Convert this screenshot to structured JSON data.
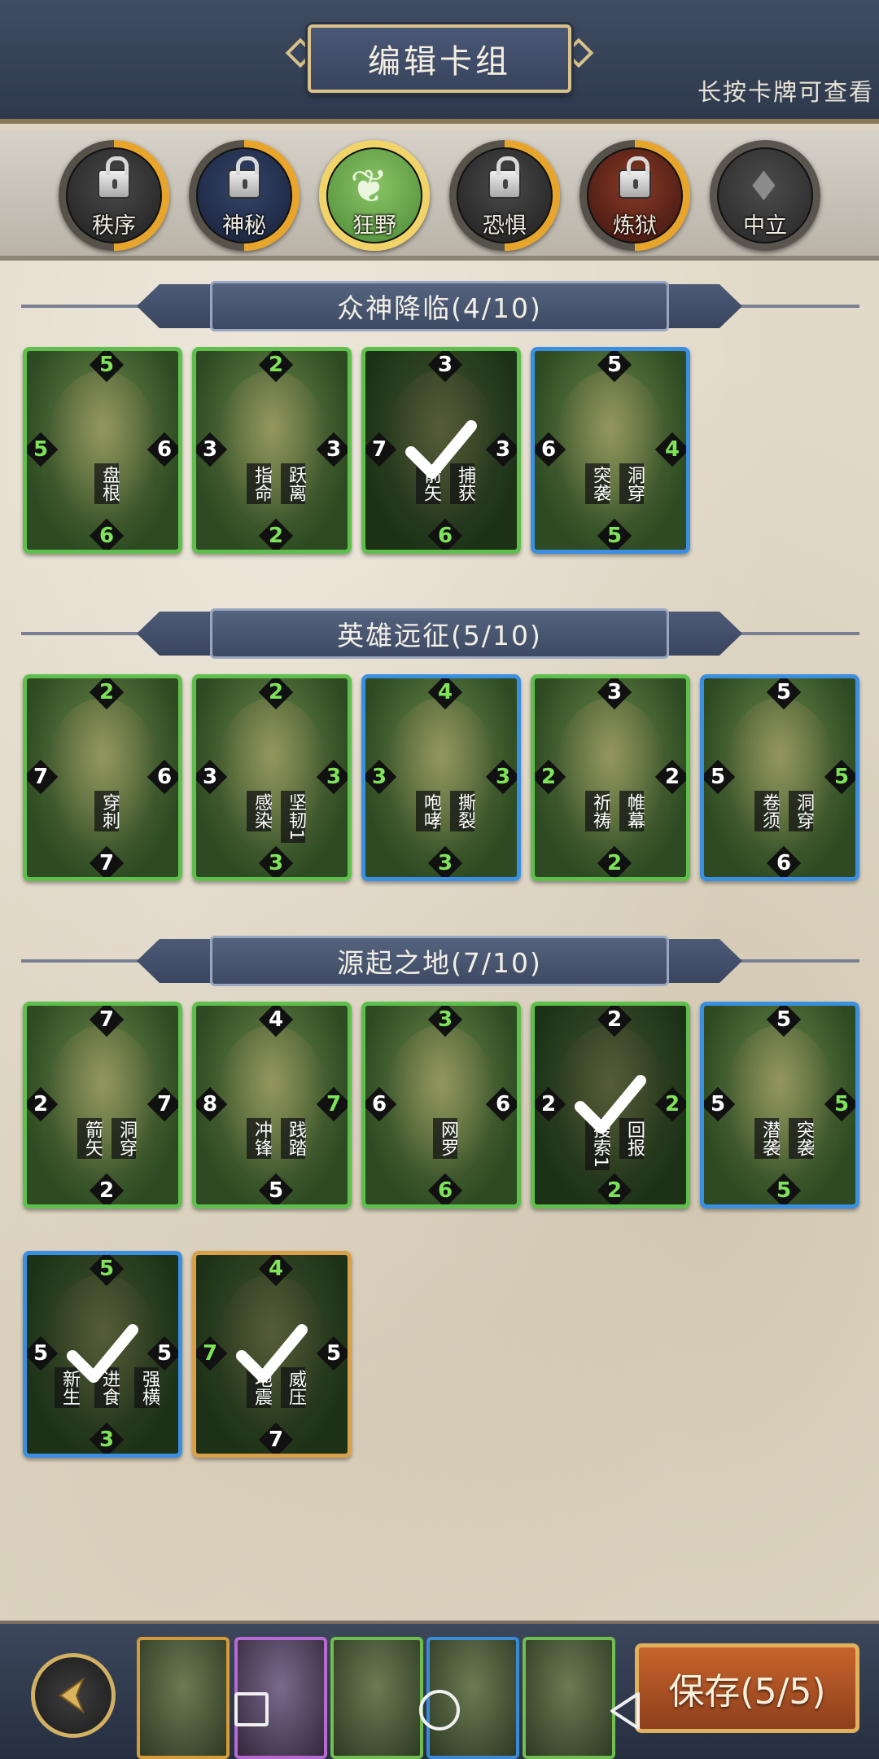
{
  "header": {
    "title": "编辑卡组",
    "hint": "长按卡牌可查看"
  },
  "factions": [
    {
      "name": "秩序",
      "locked": true
    },
    {
      "name": "神秘",
      "locked": true
    },
    {
      "name": "狂野",
      "locked": false,
      "active": true
    },
    {
      "name": "恐惧",
      "locked": true
    },
    {
      "name": "炼狱",
      "locked": true
    },
    {
      "name": "中立",
      "locked": false
    }
  ],
  "sections": [
    {
      "title": "众神降临(4/10)",
      "cards": [
        {
          "frame": "green",
          "top": "5",
          "bottom": "6",
          "left": "5",
          "right": "6",
          "top_green": true,
          "bottom_green": true,
          "left_green": true,
          "right_green": false,
          "skills": [
            "盘根"
          ],
          "selected": false
        },
        {
          "frame": "green",
          "top": "2",
          "bottom": "2",
          "left": "3",
          "right": "3",
          "top_green": true,
          "bottom_green": true,
          "left_green": false,
          "right_green": false,
          "skills": [
            "指命",
            "跃离"
          ],
          "selected": false
        },
        {
          "frame": "green",
          "top": "3",
          "bottom": "6",
          "left": "7",
          "right": "3",
          "top_green": false,
          "bottom_green": true,
          "left_green": false,
          "right_green": false,
          "skills": [
            "箭矢",
            "捕获"
          ],
          "selected": true
        },
        {
          "frame": "blue",
          "top": "5",
          "bottom": "5",
          "left": "6",
          "right": "4",
          "top_green": false,
          "bottom_green": true,
          "left_green": false,
          "right_green": true,
          "skills": [
            "突袭",
            "洞穿"
          ],
          "selected": false
        }
      ]
    },
    {
      "title": "英雄远征(5/10)",
      "cards": [
        {
          "frame": "green",
          "top": "2",
          "bottom": "7",
          "left": "7",
          "right": "6",
          "top_green": true,
          "bottom_green": false,
          "left_green": false,
          "right_green": false,
          "skills": [
            "穿刺"
          ],
          "selected": false
        },
        {
          "frame": "green",
          "top": "2",
          "bottom": "3",
          "left": "3",
          "right": "3",
          "top_green": true,
          "bottom_green": true,
          "left_green": false,
          "right_green": true,
          "skills": [
            "感染",
            "坚韧1"
          ],
          "selected": false
        },
        {
          "frame": "blue",
          "top": "4",
          "bottom": "3",
          "left": "3",
          "right": "3",
          "top_green": true,
          "bottom_green": true,
          "left_green": true,
          "right_green": true,
          "skills": [
            "咆哮",
            "撕裂"
          ],
          "selected": false
        },
        {
          "frame": "green",
          "top": "3",
          "bottom": "2",
          "left": "2",
          "right": "2",
          "top_green": false,
          "bottom_green": true,
          "left_green": true,
          "right_green": false,
          "skills": [
            "祈祷",
            "帷幕"
          ],
          "selected": false
        },
        {
          "frame": "blue",
          "top": "5",
          "bottom": "6",
          "left": "5",
          "right": "5",
          "top_green": false,
          "bottom_green": false,
          "left_green": false,
          "right_green": true,
          "skills": [
            "卷须",
            "洞穿"
          ],
          "selected": false
        }
      ]
    },
    {
      "title": "源起之地(7/10)",
      "cards": [
        {
          "frame": "green",
          "top": "7",
          "bottom": "2",
          "left": "2",
          "right": "7",
          "top_green": false,
          "bottom_green": false,
          "left_green": false,
          "right_green": false,
          "skills": [
            "箭矢",
            "洞穿"
          ],
          "selected": false
        },
        {
          "frame": "green",
          "top": "4",
          "bottom": "5",
          "left": "8",
          "right": "7",
          "top_green": false,
          "bottom_green": false,
          "left_green": false,
          "right_green": true,
          "skills": [
            "冲锋",
            "践踏"
          ],
          "selected": false
        },
        {
          "frame": "green",
          "top": "3",
          "bottom": "6",
          "left": "6",
          "right": "6",
          "top_green": true,
          "bottom_green": true,
          "left_green": false,
          "right_green": false,
          "skills": [
            "网罗"
          ],
          "selected": false
        },
        {
          "frame": "green",
          "top": "2",
          "bottom": "2",
          "left": "2",
          "right": "2",
          "top_green": false,
          "bottom_green": true,
          "left_green": false,
          "right_green": true,
          "skills": [
            "搜索1",
            "回报"
          ],
          "selected": true
        },
        {
          "frame": "blue",
          "top": "5",
          "bottom": "5",
          "left": "5",
          "right": "5",
          "top_green": false,
          "bottom_green": true,
          "left_green": false,
          "right_green": true,
          "skills": [
            "潜袭",
            "突袭"
          ],
          "selected": false
        },
        {
          "frame": "blue",
          "top": "5",
          "bottom": "3",
          "left": "5",
          "right": "5",
          "top_green": true,
          "bottom_green": true,
          "left_green": false,
          "right_green": false,
          "skills": [
            "新生",
            "进食",
            "强横"
          ],
          "selected": true
        },
        {
          "frame": "gold",
          "top": "4",
          "bottom": "7",
          "left": "7",
          "right": "5",
          "top_green": true,
          "bottom_green": false,
          "left_green": true,
          "right_green": false,
          "skills": [
            "地震",
            "威压"
          ],
          "selected": true
        }
      ]
    }
  ],
  "deck": {
    "slots": [
      "gold",
      "purple",
      "green",
      "blue",
      "green"
    ],
    "save_label": "保存(5/5)"
  },
  "icons": {
    "back": "back-arrow-icon",
    "check": "check-icon",
    "lock": "lock-icon",
    "nav_square": "recent-apps-icon",
    "nav_circle": "home-icon",
    "nav_triangle": "nav-back-icon"
  }
}
